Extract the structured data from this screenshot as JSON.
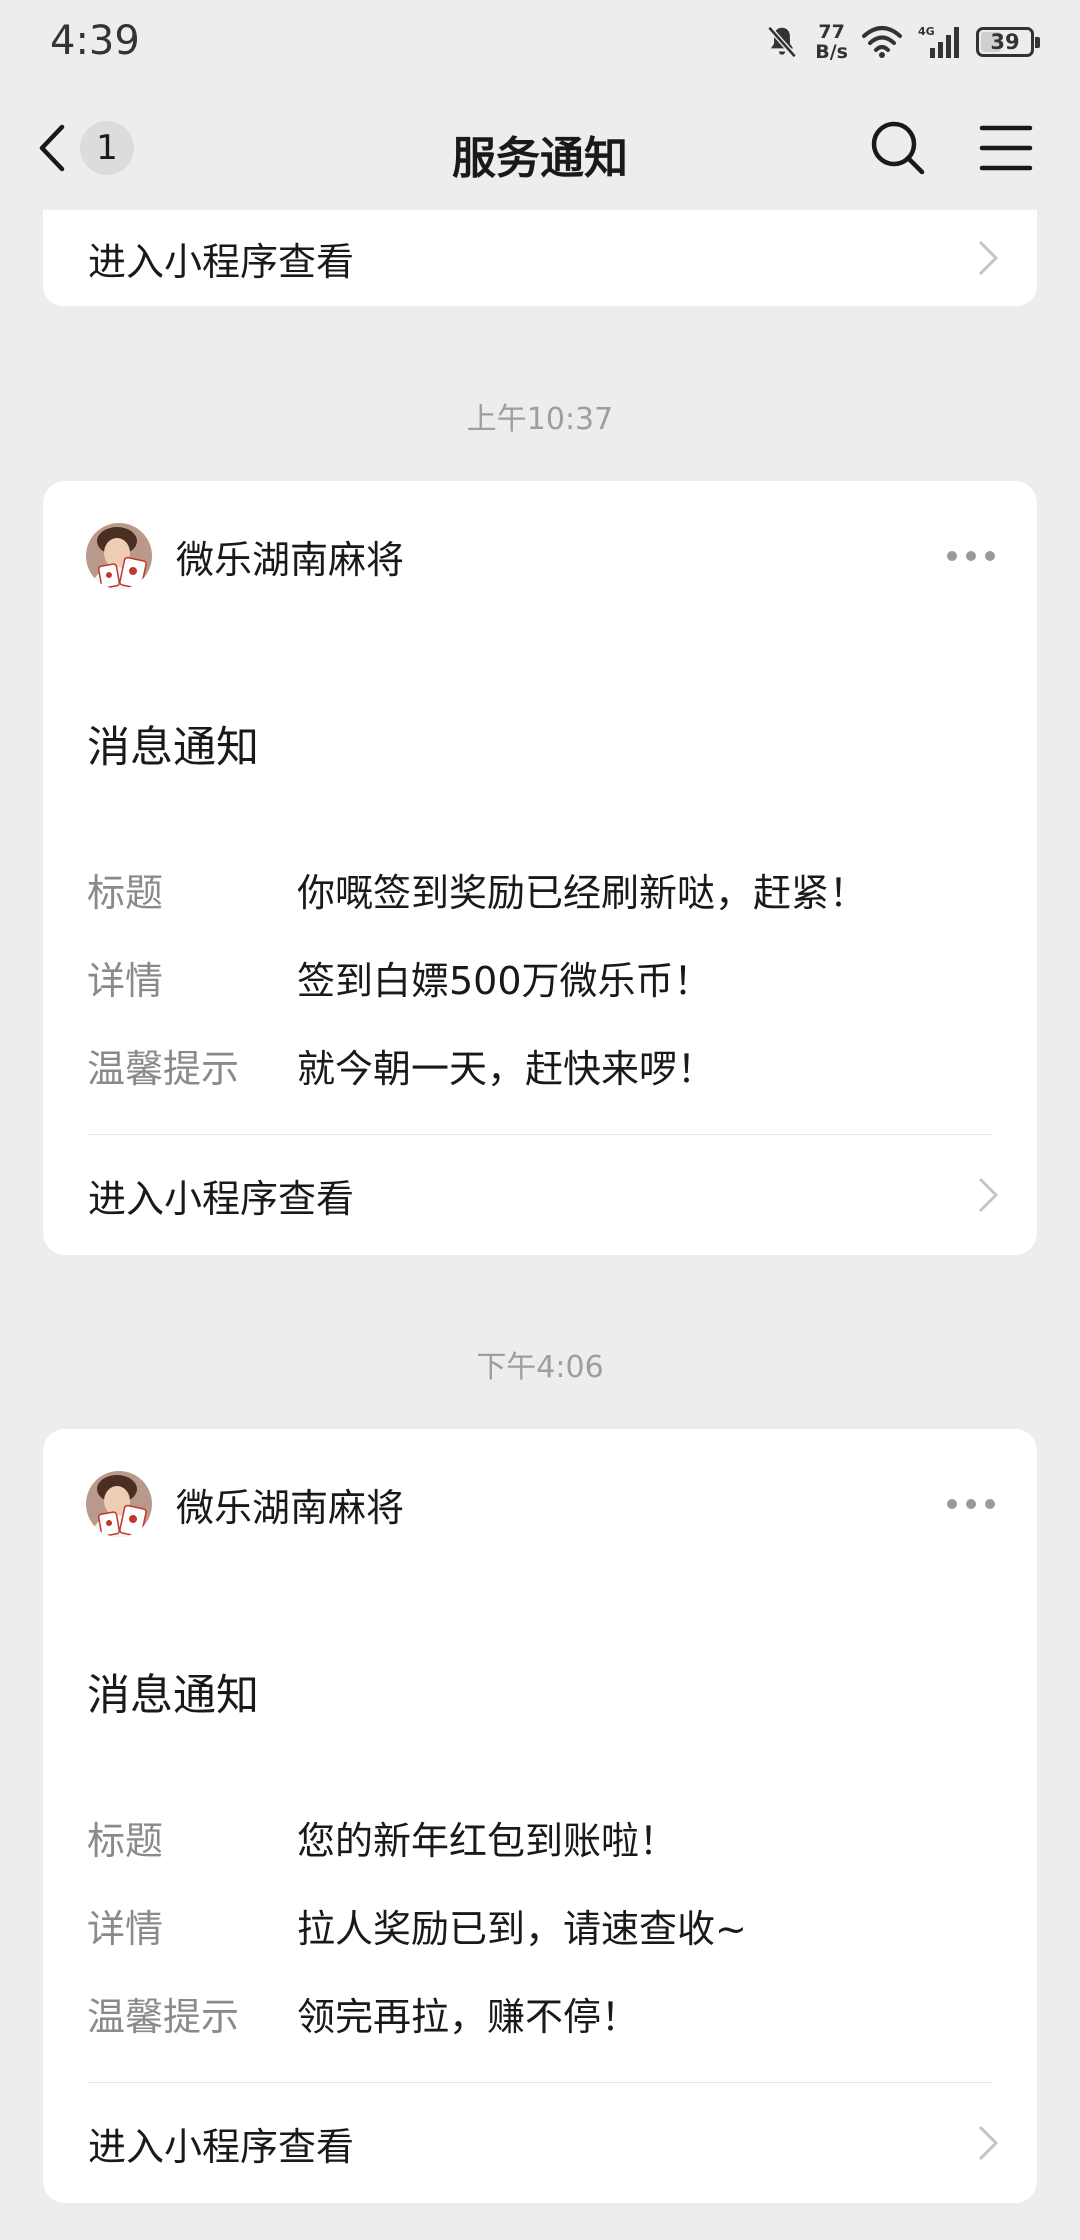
{
  "status_bar": {
    "time": "4:39",
    "net_speed_value": "77",
    "net_speed_unit": "B/s",
    "network": "4G",
    "battery_level": "39"
  },
  "nav": {
    "unread_count": "1",
    "title": "服务通知"
  },
  "top_card": {
    "link_label": "进入小程序查看"
  },
  "messages": [
    {
      "timestamp": "上午10:37",
      "sender": "微乐湖南麻将",
      "title": "消息通知",
      "fields": [
        {
          "label": "标题",
          "value": "你嘅签到奖励已经刷新哒，赶紧！"
        },
        {
          "label": "详情",
          "value": "签到白嫖500万微乐币！"
        },
        {
          "label": "温馨提示",
          "value": "就今朝一天，赶快来啰！"
        }
      ],
      "link_label": "进入小程序查看"
    },
    {
      "timestamp": "下午4:06",
      "sender": "微乐湖南麻将",
      "title": "消息通知",
      "fields": [
        {
          "label": "标题",
          "value": "您的新年红包到账啦！"
        },
        {
          "label": "详情",
          "value": "拉人奖励已到，请速查收~"
        },
        {
          "label": "温馨提示",
          "value": "领完再拉，赚不停！"
        }
      ],
      "link_label": "进入小程序查看"
    }
  ],
  "colors": {
    "background": "#ededed",
    "card": "#ffffff",
    "secondary_text": "#8a8a8a",
    "timestamp_text": "#9e9e9e"
  }
}
